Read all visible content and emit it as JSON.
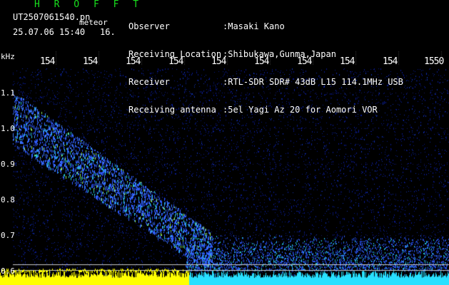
{
  "app": {
    "title": "H R O F F T"
  },
  "file": {
    "name": "UT2507061540.pn",
    "tag": "meteor",
    "datetime": "25.07.06 15:40",
    "frame": "16."
  },
  "info": {
    "labels": [
      "Observer",
      "Receiving Location",
      "Receiver",
      "Receiving antenna"
    ],
    "values": [
      ":Masaki Kano",
      ":Shibukawa,Gunma,Japan",
      ":RTL-SDR SDR# 43dB L15 114.1MHz USB",
      ":5el Yagi Az 20 for Aomori VOR"
    ]
  },
  "axis": {
    "unit": "kHz",
    "x_ticks": [
      "154",
      "154",
      "154",
      "154",
      "154",
      "154",
      "154",
      "154",
      "154",
      "1550"
    ],
    "y_ticks": [
      "1.1",
      "1.0",
      "0.9",
      "0.8",
      "0.7",
      "0.6"
    ]
  },
  "colors": {
    "title": "#19e01e",
    "background": "#000000",
    "noise": "#0a1a8c",
    "signal_low": "#2f5cff",
    "signal_mid": "#25c8d0",
    "signal_high": "#8de860",
    "baseline": "#ffff00",
    "baseline_right": "#28e0ff"
  }
}
